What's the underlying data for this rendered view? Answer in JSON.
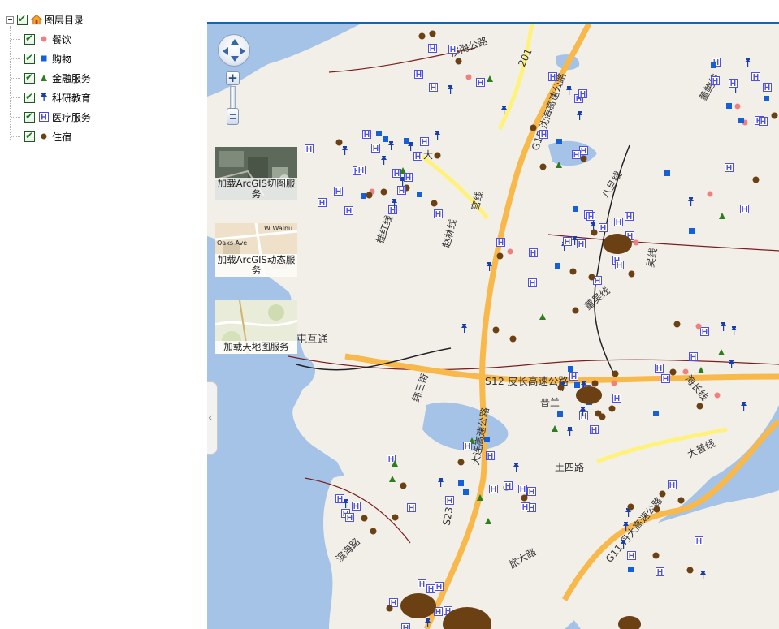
{
  "layer_tree": {
    "root_label": "图层目录",
    "root_checked": true,
    "items": [
      {
        "label": "餐饮",
        "checked": true,
        "symbol": "pink-circle",
        "color": "#f08080"
      },
      {
        "label": "购物",
        "checked": true,
        "symbol": "blue-square",
        "color": "#1560d8"
      },
      {
        "label": "金融服务",
        "checked": true,
        "symbol": "green-triangle",
        "color": "#2e7d1e"
      },
      {
        "label": "科研教育",
        "checked": true,
        "symbol": "blue-pushpin",
        "color": "#1a3fa8"
      },
      {
        "label": "医疗服务",
        "checked": true,
        "symbol": "hospital-icon",
        "color": "#4a4adf"
      },
      {
        "label": "住宿",
        "checked": true,
        "symbol": "brown-circle",
        "color": "#6b4013"
      }
    ]
  },
  "basemap_switcher": {
    "tiled": "加载ArcGIS切图服务",
    "dynamic": "加载ArcGIS动态服务",
    "tianditu": "加载天地图服务",
    "thumb_street_text_1": "W Walnu",
    "thumb_street_text_2": "Oaks Ave"
  },
  "map_labels": {
    "binhai": "滨海公路",
    "s201": "201",
    "g15": "G15 沈海高速公路",
    "dongbao": "董鲍线",
    "dafu": "大",
    "zhao": "赵",
    "gong": "宫线",
    "guihong": "桂红线",
    "zhaolin": "赵林线",
    "bayang": "八旦线",
    "xingzeng": "杨兴线",
    "wujia": "吴线",
    "zhenglu": "路",
    "dongbaoxian2": "董吴线",
    "tuhutong": "屯互通",
    "s12": "S12 皮长高速公路",
    "jiezhi": "线",
    "pusan": "普兰",
    "tulu": "土四路",
    "weisan": "纬三街",
    "zhouyuan": "线",
    "jiehai": "海长线",
    "binhai2": "滨海路",
    "s23": "S23",
    "lvda": "旅大路",
    "g11": "G11 丹大高速公路",
    "dapu": "大普线",
    "dalian_gao": "大连高速公路",
    "binhailu": "滨海路",
    "gaocheng": "高线"
  },
  "colors": {
    "sea": "#a4c3e7",
    "land": "#f2efe9",
    "highway": "#f8b84a",
    "primary_road": "#fff27a",
    "boundary": "#7a1f1f",
    "rail": "#222222"
  }
}
